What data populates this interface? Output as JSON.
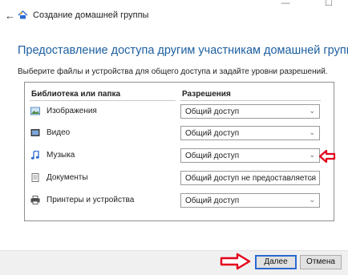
{
  "window": {
    "title": "Создание домашней группы",
    "minimize_glyph": "—",
    "maximize_glyph": "☐"
  },
  "heading": "Предоставление доступа другим участникам домашней группы",
  "instruction": "Выберите файлы и устройства для общего доступа и задайте уровни разрешений.",
  "table": {
    "col_library": "Библиотека или папка",
    "col_permissions": "Разрешения",
    "rows": [
      {
        "icon": "pictures-icon",
        "label": "Изображения",
        "permission": "Общий доступ"
      },
      {
        "icon": "videos-icon",
        "label": "Видео",
        "permission": "Общий доступ"
      },
      {
        "icon": "music-icon",
        "label": "Музыка",
        "permission": "Общий доступ"
      },
      {
        "icon": "documents-icon",
        "label": "Документы",
        "permission": "Общий доступ не предоставляется"
      },
      {
        "icon": "printer-icon",
        "label": "Принтеры и устройства",
        "permission": "Общий доступ"
      }
    ]
  },
  "buttons": {
    "next": "Далее",
    "cancel": "Отмена"
  },
  "colors": {
    "heading": "#1d5fa0",
    "annotation_arrow": "#e3001b",
    "default_button_border": "#2a6ad1"
  }
}
